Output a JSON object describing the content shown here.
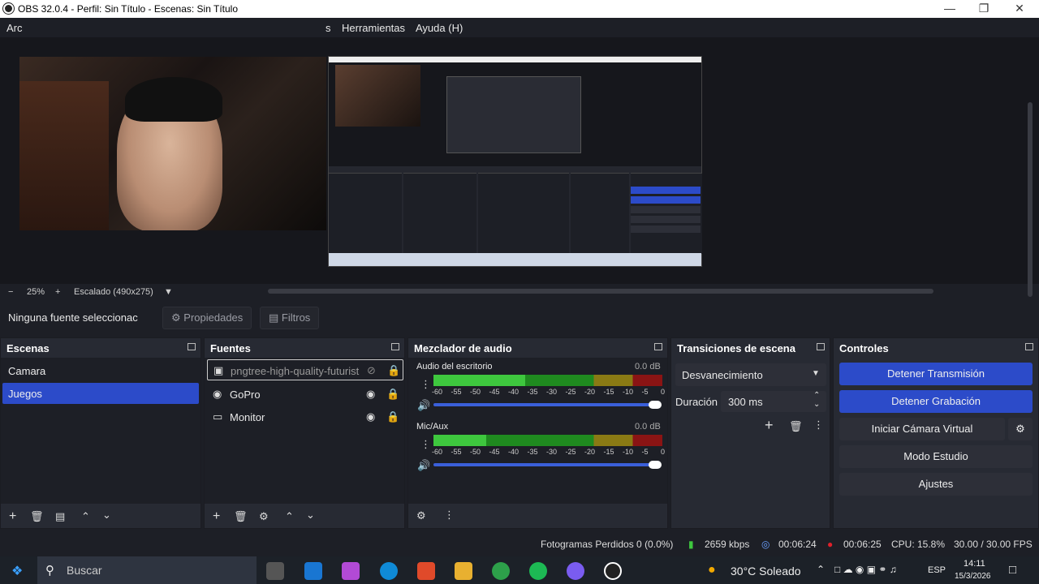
{
  "titlebar": {
    "title": "OBS 32.0.4 - Perfil: Sin Título - Escenas: Sin Título"
  },
  "menubar": {
    "items": [
      "Arc",
      "s",
      "Herramientas",
      "Ayuda (H)"
    ]
  },
  "preview": {
    "zoom": "25%",
    "scale_mode": "Escalado (490x275)"
  },
  "source_toolbar": {
    "status": "Ninguna fuente seleccionac",
    "properties": "Propiedades",
    "filters": "Filtros"
  },
  "scenes": {
    "title": "Escenas",
    "items": [
      "Camara",
      "Juegos"
    ],
    "selected": "Juegos"
  },
  "sources": {
    "title": "Fuentes",
    "items": [
      "pngtree-high-quality-futurist",
      "GoPro",
      "Monitor"
    ]
  },
  "mixer": {
    "title": "Mezclador de audio",
    "channels": [
      {
        "name": "Audio del escritorio",
        "db": "0.0 dB",
        "level": 0.4
      },
      {
        "name": "Mic/Aux",
        "db": "0.0 dB",
        "level": 0.23
      }
    ],
    "scale": [
      "-60",
      "-55",
      "-50",
      "-45",
      "-40",
      "-35",
      "-30",
      "-25",
      "-20",
      "-15",
      "-10",
      "-5",
      "0"
    ]
  },
  "transitions": {
    "title": "Transiciones de escena",
    "selected": "Desvanecimiento",
    "duration_label": "Duración",
    "duration_value": "300 ms"
  },
  "controls": {
    "title": "Controles",
    "stop_stream": "Detener Transmisión",
    "stop_record": "Detener Grabación",
    "virtual_cam": "Iniciar Cámara Virtual",
    "studio": "Modo Estudio",
    "settings": "Ajustes"
  },
  "status": {
    "dropped": "Fotogramas Perdidos 0 (0.0%)",
    "bitrate": "2659 kbps",
    "stream_time": "00:06:24",
    "rec_time": "00:06:25",
    "cpu": "CPU: 15.8%",
    "fps": "30.00 / 30.00 FPS"
  },
  "taskbar": {
    "search": "Buscar",
    "weather": "30°C Soleado",
    "lang": "ESP",
    "time": "14:11",
    "date": "15/3/2026"
  },
  "colors": {
    "accent": "#2c4bc9",
    "bg": "#1d1f26",
    "dock": "#272a33"
  }
}
